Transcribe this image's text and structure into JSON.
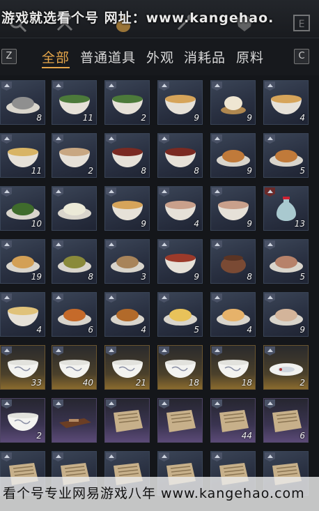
{
  "watermark_top": "游戏就选看个号  网址：www.kangehao.",
  "watermark_bottom": "看个号专业网易游戏八年 www.kangehao.com",
  "tabs": {
    "left_key": "Z",
    "right_key": "C",
    "items": [
      "全部",
      "普通道具",
      "外观",
      "消耗品",
      "原料"
    ],
    "active_index": 0
  },
  "inventory": {
    "rows": [
      [
        {
          "icon": "plate-of-fish",
          "count": "8",
          "rarity": "normal"
        },
        {
          "icon": "bowl-of-greens",
          "count": "11",
          "rarity": "normal"
        },
        {
          "icon": "bowl-of-greens",
          "count": "2",
          "rarity": "normal"
        },
        {
          "icon": "bowl-of-soup",
          "count": "9",
          "rarity": "normal"
        },
        {
          "icon": "steamed-bun",
          "count": "9",
          "rarity": "normal"
        },
        {
          "icon": "bowl-of-soup",
          "count": "4",
          "rarity": "normal"
        }
      ],
      [
        {
          "icon": "bowl-of-noodles",
          "count": "11",
          "rarity": "normal"
        },
        {
          "icon": "bowl-of-rice",
          "count": "2",
          "rarity": "normal"
        },
        {
          "icon": "bowl-of-broth",
          "count": "8",
          "rarity": "normal"
        },
        {
          "icon": "bowl-of-broth",
          "count": "8",
          "rarity": "normal"
        },
        {
          "icon": "plate-of-dish",
          "count": "9",
          "rarity": "normal"
        },
        {
          "icon": "plate-of-dish",
          "count": "5",
          "rarity": "normal"
        }
      ],
      [
        {
          "icon": "plate-of-greens",
          "count": "10",
          "rarity": "normal"
        },
        {
          "icon": "plate-of-dumplings",
          "count": "",
          "rarity": "normal"
        },
        {
          "icon": "bowl-of-soup",
          "count": "9",
          "rarity": "normal"
        },
        {
          "icon": "bowl-of-porridge",
          "count": "4",
          "rarity": "normal"
        },
        {
          "icon": "bowl-of-porridge",
          "count": "9",
          "rarity": "normal"
        },
        {
          "icon": "porcelain-vase",
          "count": "13",
          "rarity": "normal"
        }
      ],
      [
        {
          "icon": "plate-of-noodles",
          "count": "19",
          "rarity": "normal"
        },
        {
          "icon": "plate-of-beans",
          "count": "8",
          "rarity": "normal"
        },
        {
          "icon": "plate-of-meat",
          "count": "3",
          "rarity": "normal"
        },
        {
          "icon": "bowl-of-stew",
          "count": "9",
          "rarity": "normal"
        },
        {
          "icon": "clay-pot",
          "count": "8",
          "rarity": "normal"
        },
        {
          "icon": "plate-of-pork",
          "count": "5",
          "rarity": "normal"
        }
      ],
      [
        {
          "icon": "bowl-of-tofu",
          "count": "4",
          "rarity": "normal"
        },
        {
          "icon": "plate-of-meatballs",
          "count": "6",
          "rarity": "normal"
        },
        {
          "icon": "plate-of-chicken",
          "count": "4",
          "rarity": "normal"
        },
        {
          "icon": "plate-of-cake",
          "count": "5",
          "rarity": "normal"
        },
        {
          "icon": "plate-of-pastry",
          "count": "4",
          "rarity": "normal"
        },
        {
          "icon": "plate-of-bun",
          "count": "9",
          "rarity": "normal"
        }
      ],
      [
        {
          "icon": "porcelain-bowl",
          "count": "33",
          "rarity": "gold"
        },
        {
          "icon": "porcelain-bowl",
          "count": "40",
          "rarity": "gold"
        },
        {
          "icon": "porcelain-bowl",
          "count": "21",
          "rarity": "gold"
        },
        {
          "icon": "porcelain-bowl",
          "count": "18",
          "rarity": "gold"
        },
        {
          "icon": "porcelain-bowl",
          "count": "18",
          "rarity": "gold"
        },
        {
          "icon": "porcelain-plate",
          "count": "2",
          "rarity": "gold"
        }
      ],
      [
        {
          "icon": "porcelain-bowl",
          "count": "2",
          "rarity": "purple"
        },
        {
          "icon": "wooden-tray",
          "count": "",
          "rarity": "purple"
        },
        {
          "icon": "recipe-scroll",
          "count": "",
          "rarity": "purple"
        },
        {
          "icon": "recipe-scroll",
          "count": "",
          "rarity": "purple"
        },
        {
          "icon": "recipe-scroll",
          "count": "44",
          "rarity": "purple"
        },
        {
          "icon": "recipe-scroll",
          "count": "6",
          "rarity": "purple"
        }
      ],
      [
        {
          "icon": "recipe-scroll",
          "count": "",
          "rarity": "normal"
        },
        {
          "icon": "recipe-scroll",
          "count": "",
          "rarity": "normal"
        },
        {
          "icon": "recipe-scroll",
          "count": "",
          "rarity": "normal"
        },
        {
          "icon": "recipe-scroll",
          "count": "",
          "rarity": "normal"
        },
        {
          "icon": "recipe-scroll",
          "count": "",
          "rarity": "normal"
        },
        {
          "icon": "recipe-scroll",
          "count": "",
          "rarity": "normal"
        }
      ]
    ]
  },
  "colors": {
    "accent": "#e6a64a",
    "background": "#14161a",
    "slot_normal": "#2a3142",
    "slot_gold": "#8a6b2e",
    "slot_purple": "#5b4a77"
  }
}
